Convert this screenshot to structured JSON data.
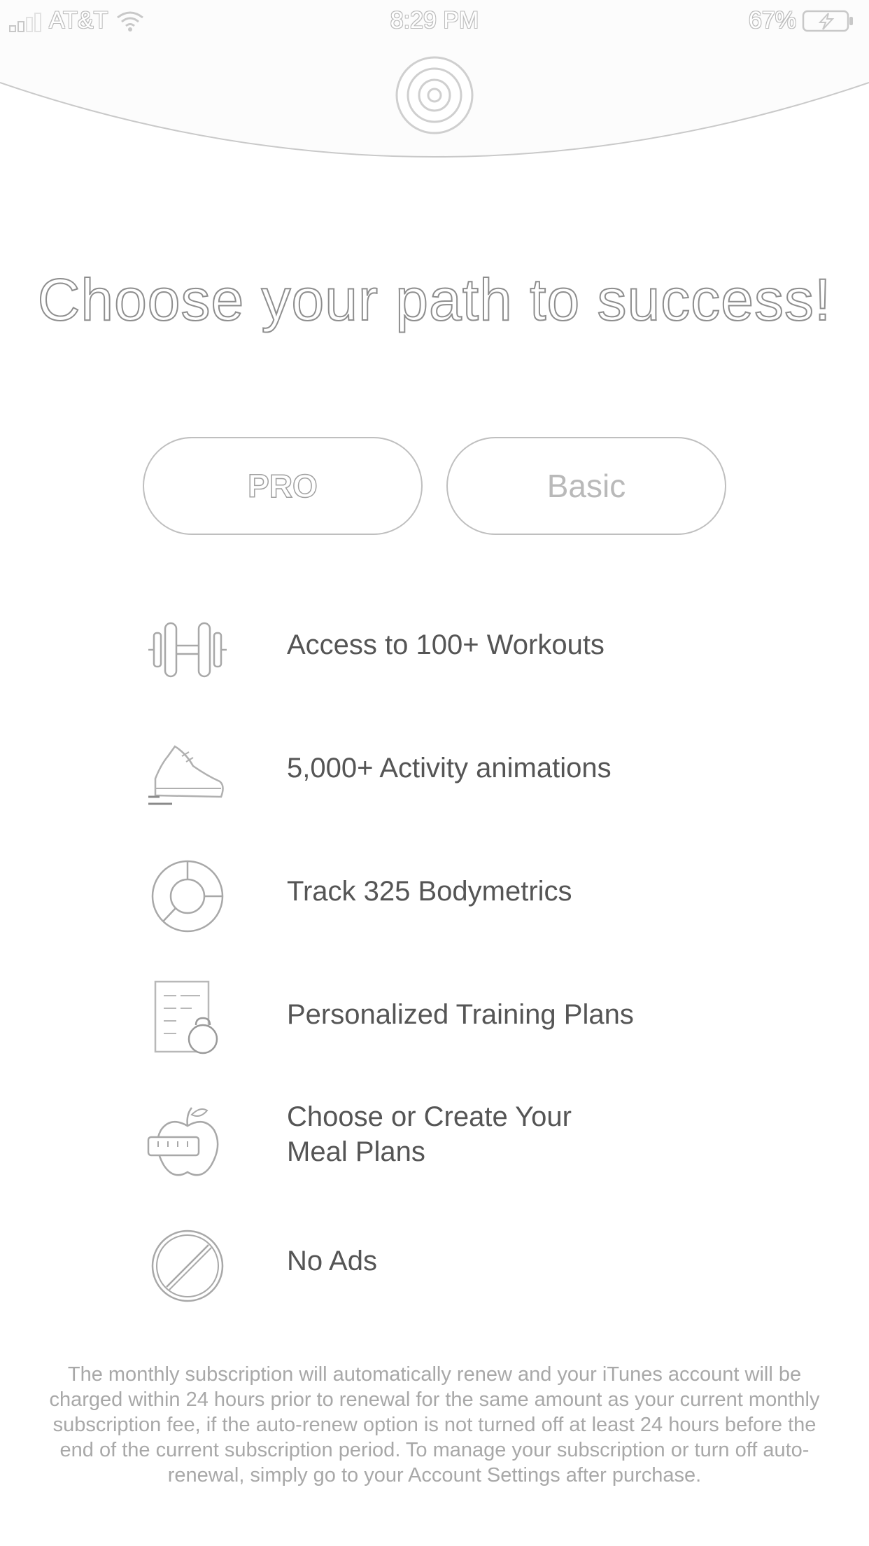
{
  "status_bar": {
    "carrier": "AT&T",
    "time": "8:29 PM",
    "battery": "67%"
  },
  "headline": "Choose your path to success!",
  "plans": {
    "pro_label": "PRO",
    "basic_label": "Basic",
    "selected": "PRO"
  },
  "features": [
    {
      "icon": "dumbbell-icon",
      "label": "Access to 100+ Workouts"
    },
    {
      "icon": "sneaker-icon",
      "label": "5,000+ Activity animations"
    },
    {
      "icon": "pie-chart-icon",
      "label": "Track 325 Bodymetrics"
    },
    {
      "icon": "training-plan-icon",
      "label": "Personalized Training Plans"
    },
    {
      "icon": "apple-meal-icon",
      "label": "Choose or Create Your\nMeal Plans"
    },
    {
      "icon": "no-ads-icon",
      "label": "No Ads"
    }
  ],
  "disclaimer": "The monthly subscription will automatically renew and your iTunes account will be charged within 24 hours prior to renewal for the same amount as your current monthly subscription fee, if the auto-renew option is not turned off at least 24 hours before the end of the current subscription period. To manage your subscription or turn off auto-renewal, simply go to your Account Settings after purchase."
}
